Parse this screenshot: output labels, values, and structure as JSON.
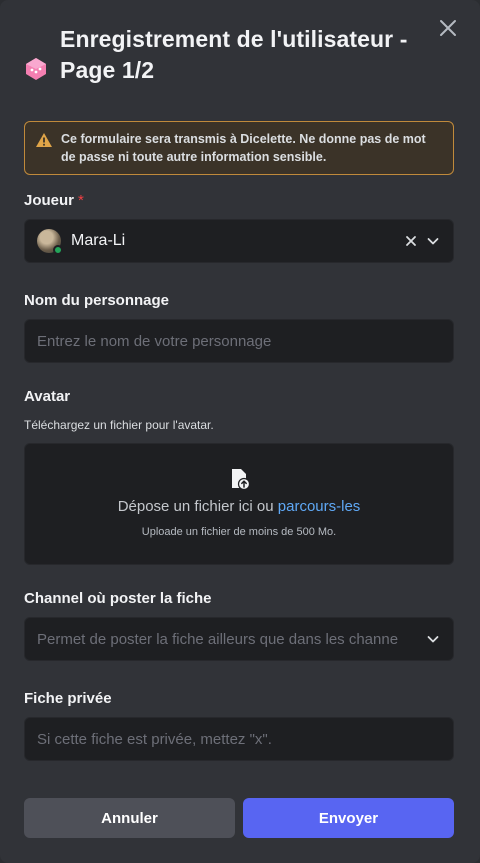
{
  "modal": {
    "title": "Enregistrement de l'utilisateur - Page 1/2",
    "app_icon": "dice-icon",
    "close_icon": "close-icon"
  },
  "warning": {
    "icon": "warning-icon",
    "text": "Ce formulaire sera transmis à Dicelette. Ne donne pas de mot de passe ni toute autre information sensible."
  },
  "player": {
    "label": "Joueur",
    "required_marker": "*",
    "selected_user": "Mara-Li",
    "status_color": "#23a55a"
  },
  "character_name": {
    "label": "Nom du personnage",
    "placeholder": "Entrez le nom de votre personnage",
    "value": ""
  },
  "avatar": {
    "label": "Avatar",
    "description": "Téléchargez un fichier pour l'avatar.",
    "drop_text": "Dépose un fichier ici ou",
    "browse_link": "parcours-les",
    "limit_text": "Uploade un fichier de moins de 500 Mo."
  },
  "channel": {
    "label": "Channel où poster la fiche",
    "placeholder": "Permet de poster la fiche ailleurs que dans les channe"
  },
  "private_sheet": {
    "label": "Fiche privée",
    "placeholder": "Si cette fiche est privée, mettez \"x\".",
    "value": ""
  },
  "buttons": {
    "cancel": "Annuler",
    "submit": "Envoyer"
  },
  "colors": {
    "background": "#313338",
    "input": "#1e1f22",
    "accent": "#5865f2",
    "warning_border": "#c08a3b",
    "link": "#5fa8f5"
  }
}
